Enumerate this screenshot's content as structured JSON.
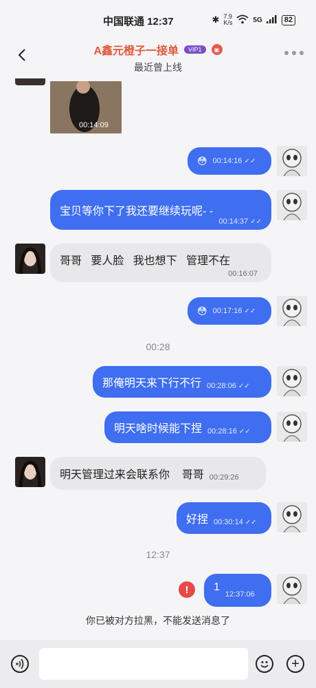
{
  "status_bar": {
    "carrier_time": "中国联通 12:37",
    "net_speed_top": "7.9",
    "net_speed_unit": "K/s",
    "net_type": "5G",
    "battery": "82"
  },
  "header": {
    "title": "A鑫元橙子一接单",
    "vip_badge": "VIP1",
    "status": "最近曾上线"
  },
  "messages": {
    "video": {
      "duration": "00:14:09"
    },
    "m1": {
      "emoji": "😳",
      "time": "00:14:16"
    },
    "m2": {
      "text": "宝贝等你下了我还要继续玩呢- -",
      "time": "00:14:37"
    },
    "m3": {
      "text": "哥哥   要人脸   我也想下   管理不在",
      "time": "00:16:07"
    },
    "m4": {
      "emoji": "😳",
      "time": "00:17:16"
    },
    "divider1": "00:28",
    "m5": {
      "text": "那俺明天来下行不行",
      "time": "00:28:06"
    },
    "m6": {
      "text": "明天啥时候能下捏",
      "time": "00:28:16"
    },
    "m7": {
      "text": "明天管理过来会联系你    哥哥",
      "time": "00:29:26"
    },
    "m8": {
      "text": "好捏",
      "time": "00:30:14"
    },
    "divider2": "12:37",
    "m9": {
      "text": "1",
      "time": "12:37:06"
    },
    "error_icon": "!"
  },
  "system_notice": "你已被对方拉黑，不能发送消息了",
  "input": {
    "placeholder": ""
  },
  "colors": {
    "out_bubble": "#3f6ef0",
    "in_bubble": "#e8e8ea",
    "title": "#e05a3c",
    "error": "#e84848"
  }
}
